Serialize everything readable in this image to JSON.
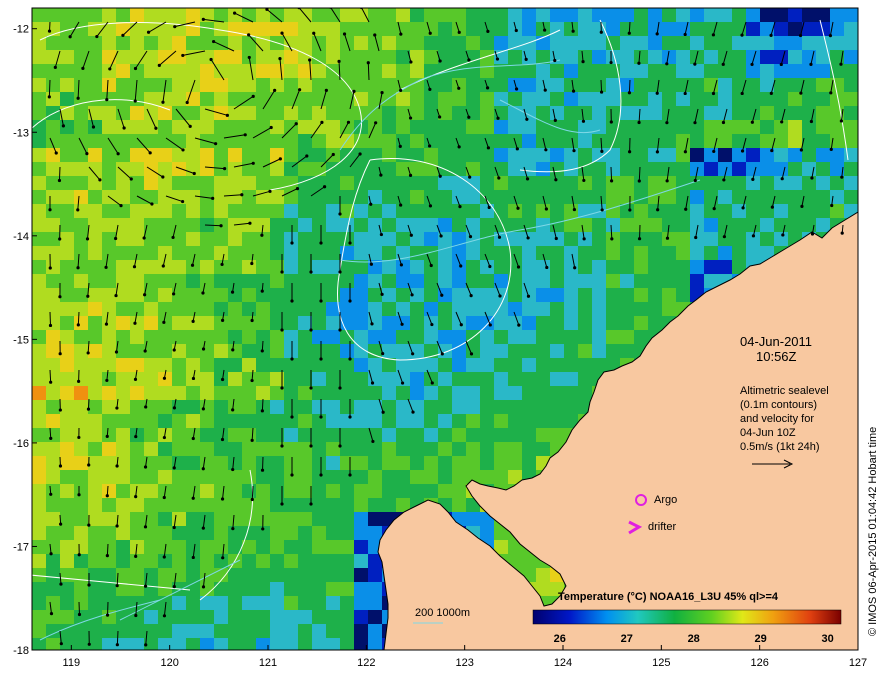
{
  "map": {
    "x_axis": {
      "range": [
        118.6,
        127
      ],
      "ticks": [
        "119",
        "120",
        "121",
        "122",
        "123",
        "124",
        "125",
        "126",
        "127"
      ]
    },
    "y_axis": {
      "range": [
        -18,
        -11.8
      ],
      "ticks": [
        "-12",
        "-13",
        "-14",
        "-15",
        "-16",
        "-17",
        "-18"
      ]
    },
    "date_text": "04-Jun-2011",
    "time_text": "10:56Z",
    "altimetry_lines": [
      "Altimetric sealevel",
      "(0.1m contours)",
      "and velocity for",
      "04-Jun 10Z",
      "0.5m/s (1kt 24h)"
    ],
    "argo_label": "Argo",
    "drifter_label": "drifter",
    "depth_label": "200  1000m",
    "credit": "© IMOS 06-Apr-2015 01:04:42 Hobart time",
    "colorbar": {
      "title": "Temperature (°C) NOAA16_L3U 45% ql>=4",
      "ticks": [
        "26",
        "27",
        "28",
        "29",
        "30"
      ],
      "range": [
        25.6,
        30.2
      ]
    },
    "colors": {
      "land": "#f8c8a0",
      "argo": "#e020e0",
      "drifter": "#e020e0",
      "contour": "#ffffff",
      "depth_contour": "#7ed8e6"
    }
  }
}
